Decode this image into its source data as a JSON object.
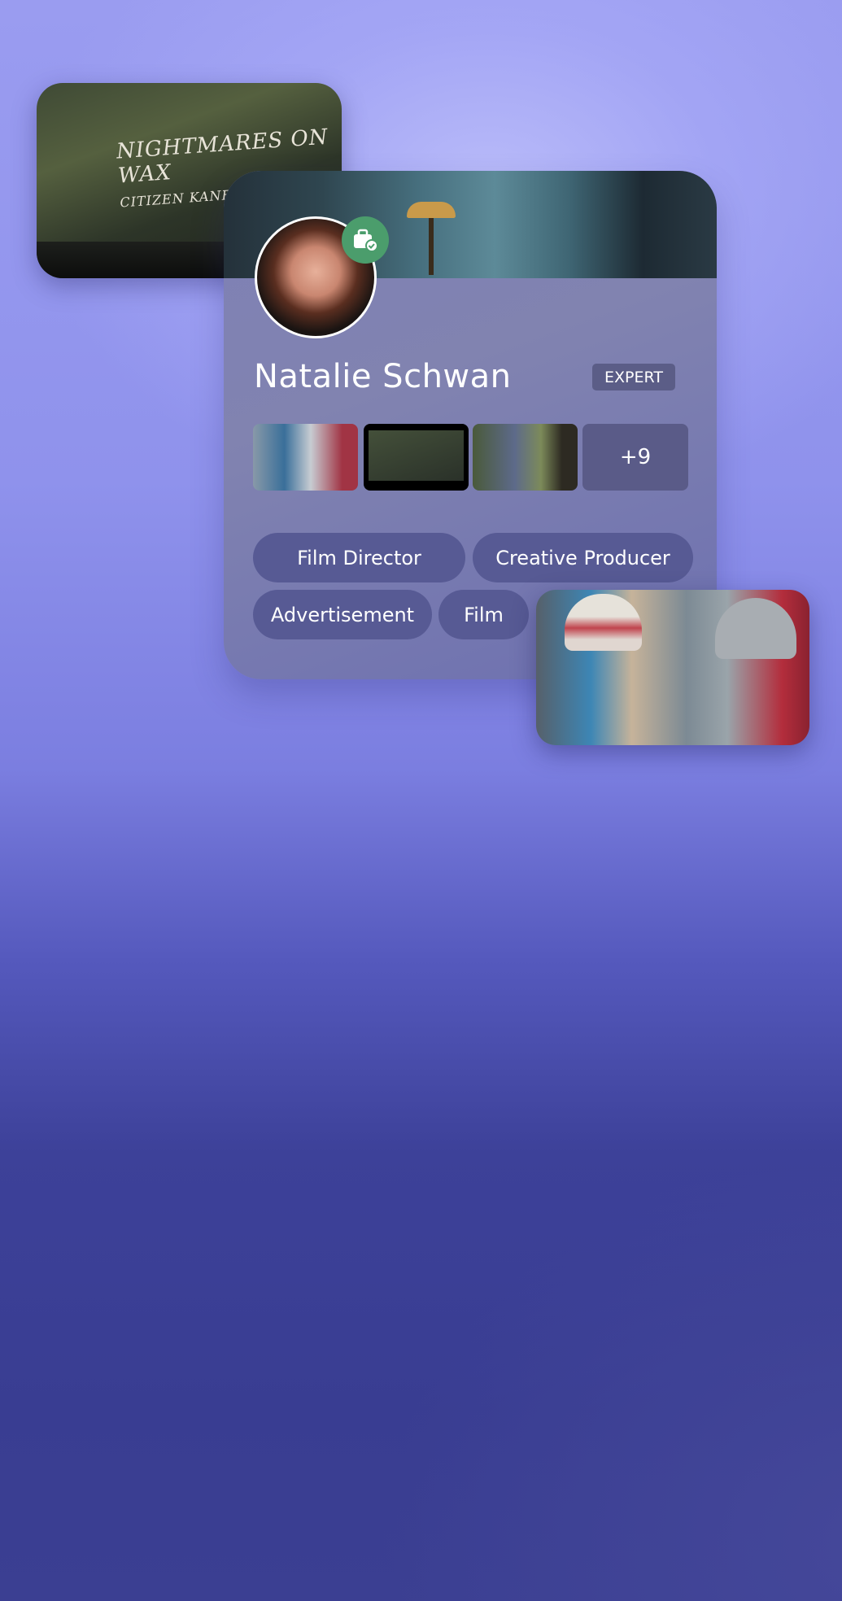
{
  "profile": {
    "name": "Natalie Schwan",
    "level_badge": "EXPERT",
    "verified_badge_icon": "briefcase-check-icon",
    "badge_color": "#4b9d6c",
    "portfolio_more": "+9",
    "tags": [
      "Film Director",
      "Creative Producer",
      "Advertisement",
      "Film"
    ]
  },
  "floating_media": {
    "top_left_title": "NIGHTMARES ON WAX",
    "top_left_subtitle": "CITIZEN KANE"
  }
}
